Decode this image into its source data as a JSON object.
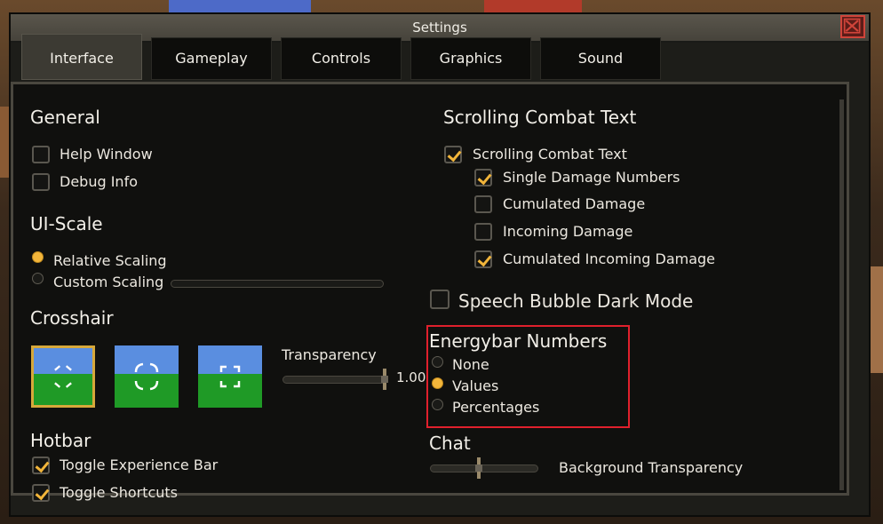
{
  "window": {
    "title": "Settings"
  },
  "tabs": [
    {
      "label": "Interface",
      "active": true
    },
    {
      "label": "Gameplay",
      "active": false
    },
    {
      "label": "Controls",
      "active": false
    },
    {
      "label": "Graphics",
      "active": false
    },
    {
      "label": "Sound",
      "active": false
    }
  ],
  "general": {
    "heading": "General",
    "help_window": {
      "label": "Help Window",
      "checked": false
    },
    "debug_info": {
      "label": "Debug Info",
      "checked": false
    }
  },
  "ui_scale": {
    "heading": "UI-Scale",
    "options": [
      {
        "label": "Relative Scaling",
        "selected": true
      },
      {
        "label": "Custom Scaling",
        "selected": false
      }
    ]
  },
  "crosshair": {
    "heading": "Crosshair",
    "selected_index": 0,
    "transparency_label": "Transparency",
    "transparency_value": "1.00"
  },
  "hotbar": {
    "heading": "Hotbar",
    "toggle_experience_bar": {
      "label": "Toggle Experience Bar",
      "checked": true
    },
    "toggle_shortcuts": {
      "label": "Toggle Shortcuts",
      "checked": true
    }
  },
  "sct": {
    "heading": "Scrolling Combat Text",
    "master": {
      "label": "Scrolling Combat Text",
      "checked": true
    },
    "single_damage": {
      "label": "Single Damage Numbers",
      "checked": true
    },
    "cumulated_damage": {
      "label": "Cumulated Damage",
      "checked": false
    },
    "incoming_damage": {
      "label": "Incoming Damage",
      "checked": false
    },
    "cumulated_incoming": {
      "label": "Cumulated Incoming Damage",
      "checked": true
    }
  },
  "speech_bubble": {
    "label": "Speech Bubble Dark Mode",
    "checked": false
  },
  "energybar": {
    "heading": "Energybar Numbers",
    "options": [
      {
        "label": "None",
        "selected": false
      },
      {
        "label": "Values",
        "selected": true
      },
      {
        "label": "Percentages",
        "selected": false
      }
    ]
  },
  "chat": {
    "heading": "Chat",
    "background_transparency_label": "Background Transparency"
  },
  "colors": {
    "accent": "#f3b63b",
    "highlight_border": "#e0202c",
    "close_red": "#d0443a"
  }
}
